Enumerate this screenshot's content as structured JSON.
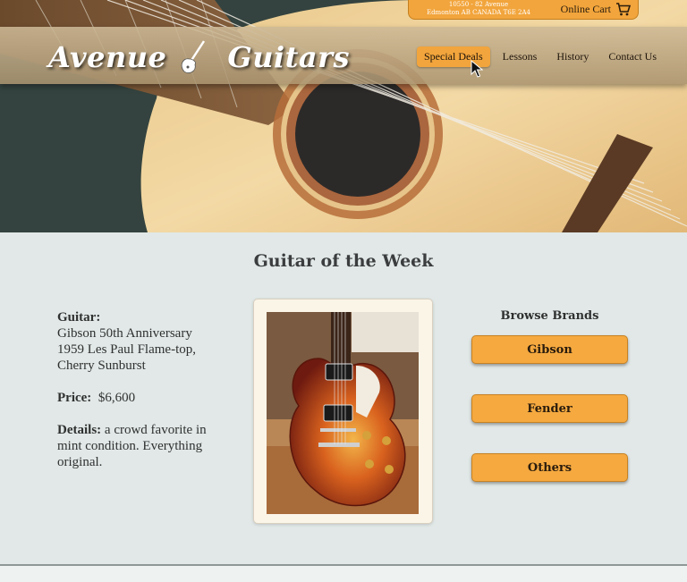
{
  "topbar": {
    "address_line1": "10550 - 82 Avenue",
    "address_line2": "Edmonton AB CANADA T6E 2A4",
    "cart_label": "Online Cart",
    "cart_icon": "shopping-cart-icon"
  },
  "logo": {
    "word1": "Avenue",
    "word2": "Guitars",
    "icon": "electric-guitar-icon"
  },
  "nav": {
    "items": [
      {
        "label": "Special Deals",
        "active": true
      },
      {
        "label": "Lessons"
      },
      {
        "label": "History"
      },
      {
        "label": "Contact Us"
      }
    ]
  },
  "main": {
    "title": "Guitar of the Week",
    "guitar": {
      "label": "Guitar:",
      "value": "Gibson 50th Anniversary 1959 Les Paul Flame-top, Cherry Sunburst"
    },
    "price": {
      "label": "Price:",
      "value": "$6,600"
    },
    "details": {
      "label": "Details:",
      "value": "a crowd favorite in mint condition. Everything original."
    }
  },
  "brands": {
    "title": "Browse Brands",
    "buttons": [
      "Gibson",
      "Fender",
      "Others"
    ]
  },
  "colors": {
    "accent": "#f5a93f",
    "page_bg": "#e1e8e7",
    "text": "#2f3130"
  }
}
